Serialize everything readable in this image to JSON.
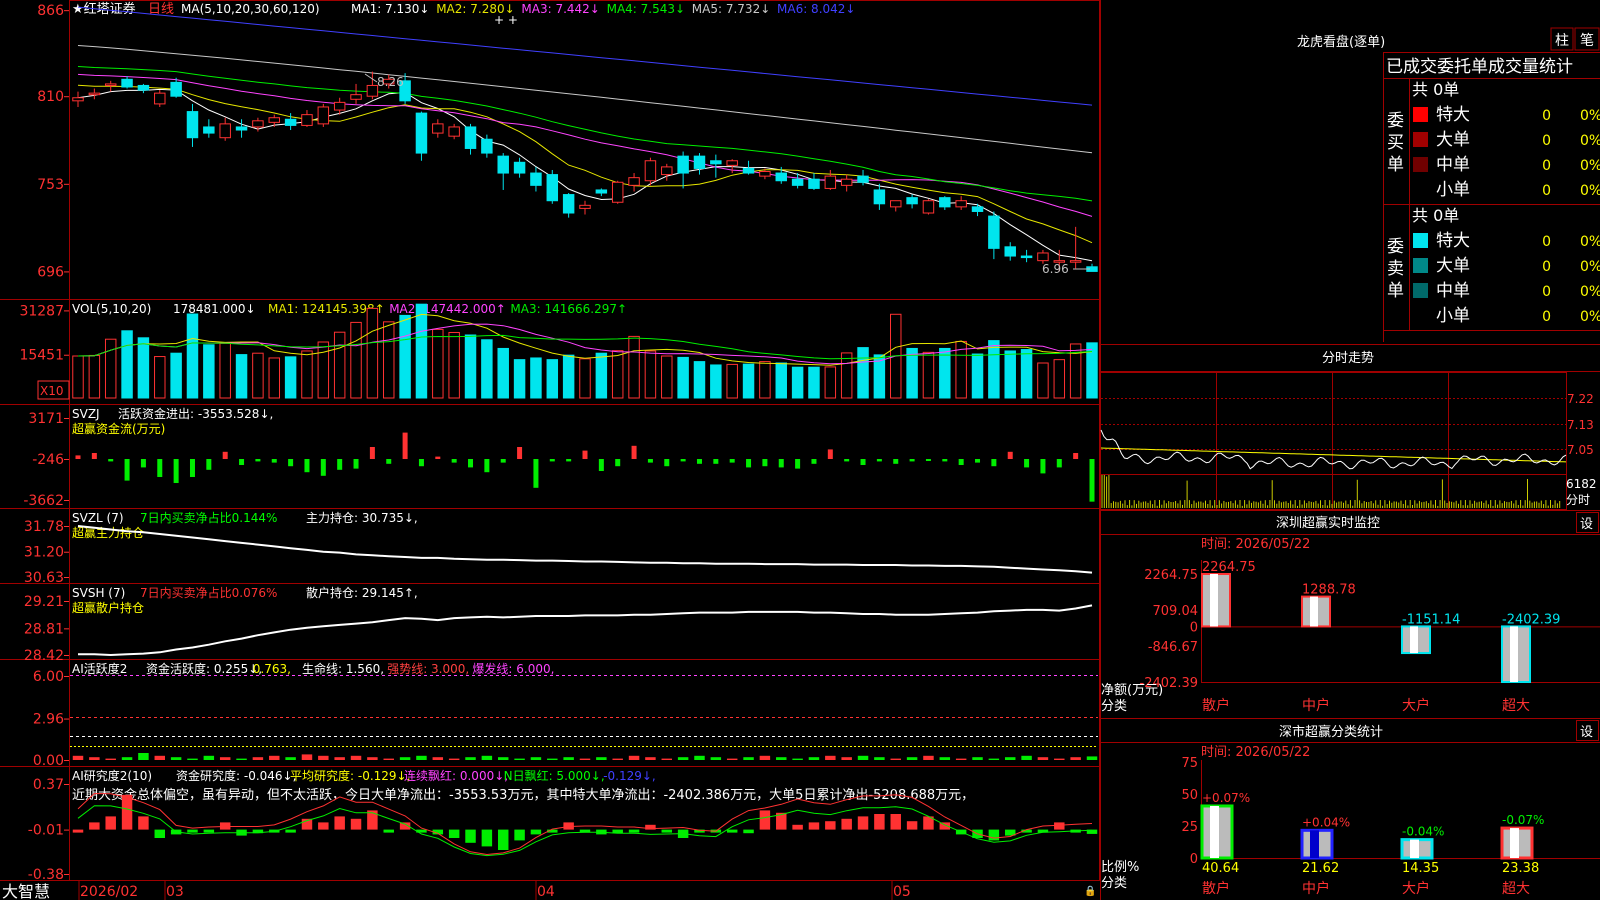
{
  "app": {
    "brand": "大智慧",
    "stock_name": "★红塔证券",
    "period": "日线"
  },
  "colors": {
    "up": "#ff3232",
    "down": "#00e5ee",
    "grid": "#a00000",
    "ma1": "#ffffff",
    "ma2": "#e6e600",
    "ma3": "#ff44ff",
    "ma4": "#00ee00",
    "ma5": "#c8c8c8",
    "ma6": "#4040ff",
    "text_white": "#ffffff",
    "text_yellow": "#ffff00",
    "text_magenta": "#ff44ff",
    "text_green": "#00ff00"
  },
  "price_panel": {
    "header": {
      "ma_params": "MA(5,10,20,30,60,120)",
      "items": [
        {
          "label": "MA1:",
          "value": "7.130↓",
          "color": "#ffffff"
        },
        {
          "label": "MA2:",
          "value": "7.280↓",
          "color": "#e6e600"
        },
        {
          "label": "MA3:",
          "value": "7.442↓",
          "color": "#ff44ff"
        },
        {
          "label": "MA4:",
          "value": "7.543↓",
          "color": "#00ee00"
        },
        {
          "label": "MA5:",
          "value": "7.732↓",
          "color": "#c8c8c8"
        },
        {
          "label": "MA6:",
          "value": "8.042↓",
          "color": "#4040ff"
        }
      ]
    },
    "ticks": [
      "866",
      "810",
      "753",
      "696"
    ],
    "annotations": {
      "high": "8.26",
      "low": "6.96"
    }
  },
  "vol_panel": {
    "header": {
      "params": "VOL(5,10,20)",
      "value": "178481.000↓",
      "items": [
        {
          "label": "MA1:",
          "value": "124145.398↑",
          "color": "#e6e600"
        },
        {
          "label": "MA2:",
          "value": "147442.000↑",
          "color": "#ff44ff"
        },
        {
          "label": "MA3:",
          "value": "141666.297↑",
          "color": "#00ee00"
        }
      ]
    },
    "ticks": [
      "31287",
      "15451"
    ],
    "unit": "X10"
  },
  "svzj_panel": {
    "header": {
      "name": "SVZJ",
      "text": "活跃资金进出: -3553.528↓,",
      "subtitle": "超赢资金流(万元)"
    },
    "ticks": [
      "3171",
      "-246",
      "-3662"
    ]
  },
  "svzl_panel": {
    "header": {
      "name": "SVZL (7)",
      "ratio": "7日内买卖净占比0.144%",
      "hold": "主力持仓: 30.735↓,",
      "subtitle": "超赢主力持仓"
    },
    "ticks": [
      "31.78",
      "31.20",
      "30.63"
    ]
  },
  "svsh_panel": {
    "header": {
      "name": "SVSH (7)",
      "ratio": "7日内买卖净占比0.076%",
      "hold": "散户持仓: 29.145↑,",
      "subtitle": "超赢散户持仓"
    },
    "ticks": [
      "29.21",
      "28.81",
      "28.42"
    ]
  },
  "ai1_panel": {
    "header": {
      "name": "AI活跃度2",
      "items": [
        {
          "text": "资金活跃度: 0.255↓,",
          "color": "#ffffff"
        },
        {
          "text": "0.763,",
          "color": "#ffff00"
        },
        {
          "text": "生命线: 1.560,",
          "color": "#ffffff"
        },
        {
          "text": "强势线: 3.000,",
          "color": "#ff4040"
        },
        {
          "text": "爆发线: 6.000,",
          "color": "#ff44ff"
        }
      ]
    },
    "ticks": [
      "6.00",
      "2.96",
      "0.00"
    ]
  },
  "ai2_panel": {
    "header": {
      "name": "AI研究度2(10)",
      "items": [
        {
          "text": "资金研究度: -0.046↓,",
          "color": "#ffffff"
        },
        {
          "text": "平均研究度: -0.129↓,",
          "color": "#ffff00"
        },
        {
          "text": "连续飘红: 0.000↓,",
          "color": "#ff44ff"
        },
        {
          "text": "N日飘红: 5.000↓,",
          "color": "#00ff00"
        },
        {
          "text": "-0.129↓,",
          "color": "#4040ff"
        }
      ]
    },
    "comment": "近期大资金总体偏空，虽有异动，但不太活跃，今日大单净流出：-3553.53万元，其中特大单净流出：-2402.386万元，大单5日累计净出-5208.688万元，",
    "ticks": [
      "0.37",
      "-0.01",
      "-0.38"
    ]
  },
  "x_axis": {
    "labels": [
      "2026/02",
      "03",
      "04",
      "05"
    ]
  },
  "dragon_tiger": {
    "title": "龙虎看盘(逐单)",
    "buttons": [
      "柱",
      "笔"
    ],
    "header": "已成交委托单成交量统计",
    "buy": {
      "side_label": "委买单",
      "total": "共 0单",
      "rows": [
        {
          "name": "特大",
          "count": "0",
          "pct": "0%",
          "color": "#ff0000"
        },
        {
          "name": "大单",
          "count": "0",
          "pct": "0%",
          "color": "#a00000"
        },
        {
          "name": "中单",
          "count": "0",
          "pct": "0%",
          "color": "#700000"
        },
        {
          "name": "小单",
          "count": "0",
          "pct": "0%",
          "color": ""
        }
      ]
    },
    "sell": {
      "side_label": "委卖单",
      "total": "共 0单",
      "rows": [
        {
          "name": "特大",
          "count": "0",
          "pct": "0%",
          "color": "#00e5ee"
        },
        {
          "name": "大单",
          "count": "0",
          "pct": "0%",
          "color": "#008888"
        },
        {
          "name": "中单",
          "count": "0",
          "pct": "0%",
          "color": "#006a6a"
        },
        {
          "name": "小单",
          "count": "0",
          "pct": "0%",
          "color": ""
        }
      ]
    }
  },
  "intraday": {
    "title": "分时走势",
    "ticks": [
      "7.22",
      "7.13",
      "7.05"
    ],
    "vol_tick": "6182",
    "vol_label": "分时"
  },
  "sz_monitor": {
    "title": "深圳超赢实时监控",
    "settings": "设",
    "time": "时间: 2026/05/22",
    "y_ticks": [
      "2264.75",
      "709.04",
      "0",
      "-846.67",
      "-2402.39"
    ],
    "y_label": "净额(万元)",
    "x_label": "分类",
    "categories": [
      "散户",
      "中户",
      "大户",
      "超大"
    ],
    "values": [
      "2264.75",
      "1288.78",
      "-1151.14",
      "-2402.39"
    ]
  },
  "sz_class": {
    "title": "深市超赢分类统计",
    "settings": "设",
    "time": "时间: 2026/05/22",
    "y_ticks": [
      "75",
      "50",
      "25",
      "0"
    ],
    "y_label": "比例%",
    "x_label": "分类",
    "categories": [
      "散户",
      "中户",
      "大户",
      "超大"
    ],
    "values": [
      "40.64",
      "21.62",
      "14.35",
      "23.38"
    ],
    "changes": [
      "+0.07%",
      "+0.04%",
      "-0.04%",
      "-0.07%"
    ]
  },
  "chart_data": [
    {
      "type": "candlestick",
      "title": "红塔证券 日线",
      "ylim": [
        6.8,
        8.7
      ],
      "ohlc": [
        [
          8.07,
          8.13,
          8.03,
          8.09
        ],
        [
          8.11,
          8.15,
          8.08,
          8.12
        ],
        [
          8.17,
          8.2,
          8.13,
          8.18
        ],
        [
          8.21,
          8.23,
          8.15,
          8.16
        ],
        [
          8.17,
          8.18,
          8.12,
          8.14
        ],
        [
          8.05,
          8.14,
          8.03,
          8.12
        ],
        [
          8.19,
          8.22,
          8.09,
          8.1
        ],
        [
          8.0,
          8.05,
          7.77,
          7.83
        ],
        [
          7.9,
          7.95,
          7.83,
          7.86
        ],
        [
          7.83,
          7.96,
          7.81,
          7.92
        ],
        [
          7.9,
          7.95,
          7.83,
          7.88
        ],
        [
          7.9,
          7.96,
          7.87,
          7.94
        ],
        [
          7.93,
          7.98,
          7.9,
          7.96
        ],
        [
          7.95,
          7.99,
          7.88,
          7.91
        ],
        [
          7.91,
          8.01,
          7.9,
          7.98
        ],
        [
          7.92,
          8.05,
          7.9,
          8.03
        ],
        [
          8.01,
          8.09,
          7.98,
          8.06
        ],
        [
          8.08,
          8.18,
          8.05,
          8.11
        ],
        [
          8.1,
          8.26,
          8.08,
          8.17
        ],
        [
          8.18,
          8.24,
          8.15,
          8.21
        ],
        [
          8.2,
          8.25,
          8.05,
          8.07
        ],
        [
          7.99,
          8.0,
          7.68,
          7.73
        ],
        [
          7.86,
          7.95,
          7.83,
          7.92
        ],
        [
          7.84,
          7.92,
          7.82,
          7.9
        ],
        [
          7.9,
          7.92,
          7.72,
          7.76
        ],
        [
          7.82,
          7.85,
          7.7,
          7.73
        ],
        [
          7.71,
          7.73,
          7.49,
          7.6
        ],
        [
          7.67,
          7.7,
          7.57,
          7.6
        ],
        [
          7.6,
          7.64,
          7.48,
          7.52
        ],
        [
          7.59,
          7.62,
          7.4,
          7.42
        ],
        [
          7.46,
          7.47,
          7.31,
          7.34
        ],
        [
          7.37,
          7.42,
          7.33,
          7.39
        ],
        [
          7.49,
          7.5,
          7.45,
          7.47
        ],
        [
          7.41,
          7.55,
          7.4,
          7.54
        ],
        [
          7.52,
          7.6,
          7.48,
          7.57
        ],
        [
          7.55,
          7.7,
          7.52,
          7.68
        ],
        [
          7.59,
          7.66,
          7.55,
          7.64
        ],
        [
          7.71,
          7.74,
          7.5,
          7.6
        ],
        [
          7.71,
          7.73,
          7.59,
          7.63
        ],
        [
          7.68,
          7.72,
          7.57,
          7.66
        ],
        [
          7.65,
          7.69,
          7.6,
          7.68
        ],
        [
          7.63,
          7.68,
          7.59,
          7.6
        ],
        [
          7.58,
          7.63,
          7.56,
          7.61
        ],
        [
          7.6,
          7.64,
          7.53,
          7.55
        ],
        [
          7.56,
          7.6,
          7.5,
          7.52
        ],
        [
          7.56,
          7.6,
          7.49,
          7.5
        ],
        [
          7.5,
          7.62,
          7.49,
          7.58
        ],
        [
          7.52,
          7.59,
          7.48,
          7.56
        ],
        [
          7.58,
          7.62,
          7.52,
          7.54
        ],
        [
          7.49,
          7.53,
          7.36,
          7.4
        ],
        [
          7.38,
          7.42,
          7.35,
          7.42
        ],
        [
          7.44,
          7.46,
          7.37,
          7.4
        ],
        [
          7.34,
          7.43,
          7.33,
          7.42
        ],
        [
          7.44,
          7.45,
          7.36,
          7.38
        ],
        [
          7.38,
          7.45,
          7.36,
          7.42
        ],
        [
          7.38,
          7.4,
          7.32,
          7.35
        ],
        [
          7.32,
          7.35,
          7.04,
          7.11
        ],
        [
          7.12,
          7.15,
          7.03,
          7.06
        ],
        [
          7.06,
          7.1,
          7.02,
          7.05
        ],
        [
          7.03,
          7.1,
          7.01,
          7.08
        ],
        [
          7.02,
          7.1,
          6.96,
          7.03
        ],
        [
          7.02,
          7.25,
          6.98,
          7.03
        ],
        [
          6.99,
          7.01,
          6.96,
          6.96
        ]
      ]
    },
    {
      "type": "bar",
      "title": "VOL(5,10,20)",
      "unit": "X10",
      "ylim": [
        0,
        35000
      ],
      "values": [
        15000,
        15200,
        21000,
        24000,
        21500,
        14800,
        16000,
        30000,
        19000,
        19500,
        15500,
        16000,
        14300,
        14700,
        16800,
        20000,
        23500,
        27000,
        32000,
        27200,
        29500,
        33500,
        24500,
        23400,
        22500,
        20800,
        17700,
        13700,
        14300,
        13700,
        15300,
        14000,
        16000,
        16900,
        22000,
        16800,
        15000,
        14500,
        13000,
        11800,
        12000,
        12100,
        13000,
        12500,
        11000,
        11000,
        11100,
        16100,
        18000,
        15400,
        29900,
        17700,
        16300,
        17700,
        20200,
        15700,
        20500,
        16800,
        17300,
        12500,
        13700,
        19300,
        19700
      ]
    },
    {
      "type": "bar",
      "title": "SVZJ",
      "ylim": [
        -3662,
        3171
      ],
      "values": [
        300,
        500,
        -200,
        -1800,
        -700,
        -1500,
        -2000,
        -1500,
        -900,
        600,
        -500,
        -200,
        -300,
        -600,
        -1100,
        -1400,
        -900,
        -800,
        1000,
        -400,
        2200,
        -600,
        200,
        -300,
        -700,
        -1100,
        -300,
        1000,
        -2400,
        -200,
        -200,
        700,
        -1000,
        -600,
        1100,
        -300,
        -600,
        -200,
        -400,
        -400,
        -300,
        -700,
        -600,
        -700,
        -800,
        -400,
        800,
        -200,
        -500,
        -200,
        -400,
        -200,
        -100,
        -200,
        -500,
        -300,
        -600,
        600,
        -700,
        -1200,
        -700,
        500,
        -3553
      ]
    },
    {
      "type": "line",
      "title": "SVZL (7)",
      "ylim": [
        30.63,
        31.78
      ],
      "values": [
        31.78,
        31.74,
        31.7,
        31.66,
        31.64,
        31.6,
        31.56,
        31.52,
        31.48,
        31.44,
        31.4,
        31.36,
        31.32,
        31.28,
        31.24,
        31.2,
        31.18,
        31.14,
        31.12,
        31.1,
        31.08,
        31.06,
        31.06,
        31.04,
        31.03,
        31.02,
        31.02,
        31.01,
        31.0,
        31.0,
        30.99,
        30.98,
        30.98,
        30.97,
        30.96,
        30.95,
        30.95,
        30.94,
        30.94,
        30.93,
        30.93,
        30.93,
        30.92,
        30.92,
        30.92,
        30.91,
        30.91,
        30.91,
        30.9,
        30.9,
        30.9,
        30.89,
        30.89,
        30.88,
        30.88,
        30.87,
        30.86,
        30.84,
        30.82,
        30.8,
        30.78,
        30.76,
        30.73
      ]
    },
    {
      "type": "line",
      "title": "SVSH (7)",
      "ylim": [
        28.42,
        29.21
      ],
      "values": [
        28.43,
        28.43,
        28.42,
        28.43,
        28.44,
        28.46,
        28.5,
        28.53,
        28.57,
        28.62,
        28.66,
        28.71,
        28.75,
        28.79,
        28.82,
        28.84,
        28.86,
        28.88,
        28.9,
        28.93,
        28.96,
        28.95,
        28.93,
        28.96,
        28.97,
        28.98,
        28.97,
        28.98,
        28.99,
        28.99,
        28.99,
        29.0,
        29.0,
        29.0,
        29.01,
        29.01,
        29.02,
        29.03,
        29.04,
        29.04,
        29.04,
        29.05,
        29.05,
        29.05,
        29.05,
        29.04,
        29.04,
        29.03,
        29.02,
        29.02,
        29.01,
        29.01,
        29.01,
        29.02,
        29.03,
        29.04,
        29.06,
        29.07,
        29.08,
        29.08,
        29.07,
        29.1,
        29.145
      ]
    },
    {
      "type": "bar",
      "title": "AI活跃度2",
      "ylim": [
        0,
        6.0
      ],
      "values": [
        0.3,
        0.2,
        0.1,
        0.2,
        0.5,
        0.3,
        0.2,
        0.1,
        0.3,
        0.2,
        0.1,
        0.2,
        0.3,
        0.2,
        0.4,
        0.3,
        0.2,
        0.3,
        0.2,
        0.1,
        0.2,
        0.3,
        0.2,
        0.1,
        0.2,
        0.3,
        0.2,
        0.1,
        0.2,
        0.1,
        0.2,
        0.1,
        0.2,
        0.1,
        0.3,
        0.2,
        0.1,
        0.2,
        0.3,
        0.2,
        0.1,
        0.2,
        0.3,
        0.2,
        0.1,
        0.2,
        0.3,
        0.2,
        0.3,
        0.2,
        0.1,
        0.2,
        0.3,
        0.2,
        0.1,
        0.2,
        0.1,
        0.2,
        0.3,
        0.2,
        0.1,
        0.2,
        0.255
      ]
    },
    {
      "type": "bar",
      "title": "AI研究度2(10)",
      "ylim": [
        -0.38,
        0.37
      ],
      "values": [
        -0.01,
        0.05,
        0.1,
        0.28,
        0.1,
        -0.08,
        -0.05,
        -0.03,
        -0.02,
        0.05,
        -0.06,
        -0.04,
        -0.03,
        -0.02,
        0.08,
        0.05,
        0.1,
        0.08,
        0.15,
        -0.02,
        0.05,
        -0.03,
        -0.05,
        -0.08,
        -0.12,
        -0.15,
        -0.18,
        -0.1,
        -0.05,
        -0.03,
        0.05,
        -0.02,
        -0.05,
        -0.04,
        -0.03,
        0.03,
        -0.02,
        -0.08,
        -0.03,
        -0.02,
        -0.02,
        -0.04,
        0.15,
        0.13,
        0.03,
        0.05,
        0.06,
        0.08,
        0.1,
        0.12,
        0.12,
        0.06,
        0.1,
        0.05,
        -0.05,
        -0.08,
        -0.1,
        -0.06,
        -0.03,
        -0.02,
        0.05,
        -0.03,
        -0.046
      ]
    },
    {
      "type": "bar",
      "title": "深圳超赢实时监控",
      "categories": [
        "散户",
        "中户",
        "大户",
        "超大"
      ],
      "values": [
        2264.75,
        1288.78,
        -1151.14,
        -2402.39
      ],
      "ylim": [
        -2402.39,
        2264.75
      ]
    },
    {
      "type": "bar",
      "title": "深市超赢分类统计",
      "categories": [
        "散户",
        "中户",
        "大户",
        "超大"
      ],
      "values": [
        40.64,
        21.62,
        14.35,
        23.38
      ],
      "ylim": [
        0,
        75
      ]
    }
  ]
}
